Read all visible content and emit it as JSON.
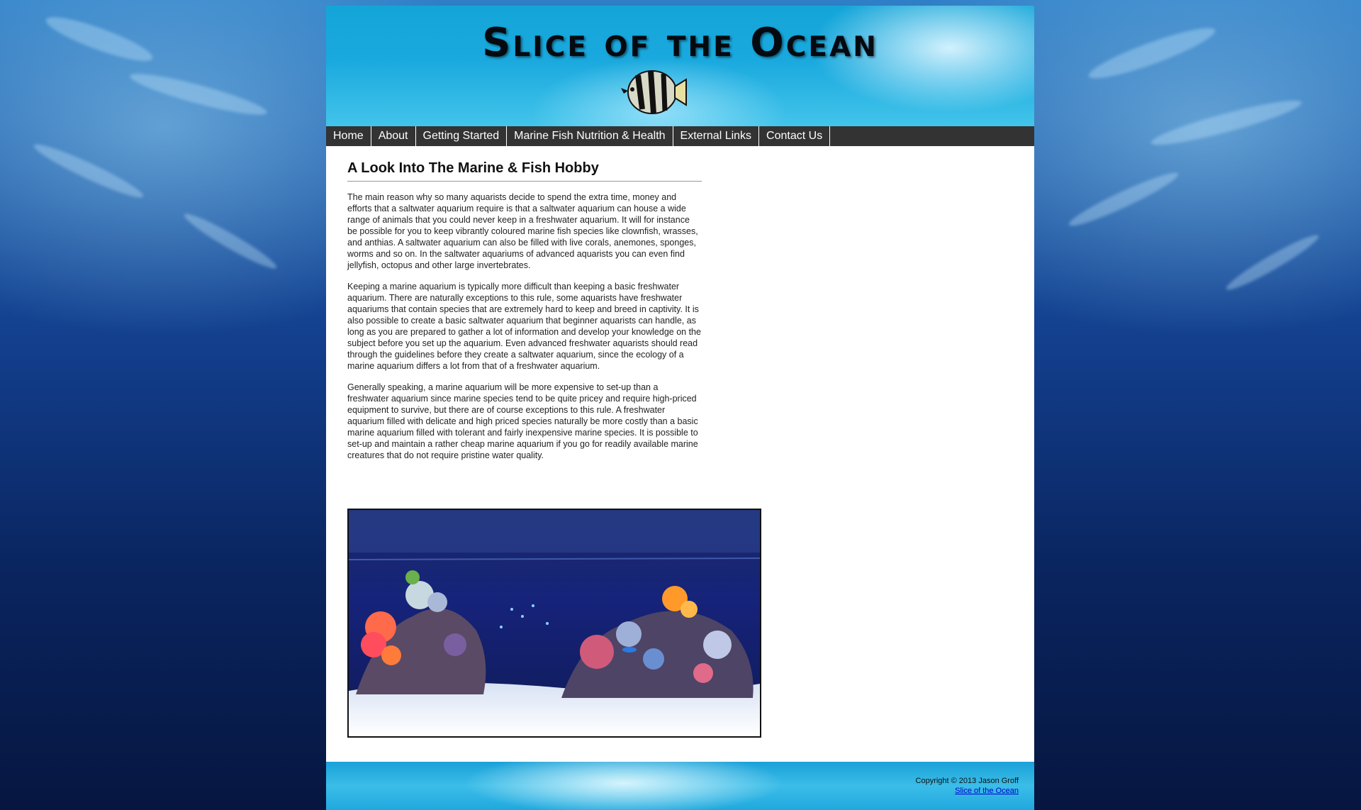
{
  "site": {
    "title": "Slice of the Ocean"
  },
  "nav": {
    "items": [
      {
        "label": "Home"
      },
      {
        "label": "About"
      },
      {
        "label": "Getting Started"
      },
      {
        "label": "Marine Fish Nutrition & Health"
      },
      {
        "label": "External Links"
      },
      {
        "label": "Contact Us"
      }
    ]
  },
  "main": {
    "heading": "A Look Into The Marine & Fish Hobby",
    "paragraphs": [
      "The main reason why so many aquarists decide to spend the extra time, money and efforts that a saltwater aquarium require is that a saltwater aquarium can house a wide range of animals that you could never keep in a freshwater aquarium. It will for instance be possible for you to keep vibrantly coloured marine fish species like clownfish, wrasses, and anthias. A saltwater aquarium can also be filled with live corals, anemones, sponges, worms and so on. In the saltwater aquariums of advanced aquarists you can even find jellyfish, octopus and other large invertebrates.",
      "Keeping a marine aquarium is typically more difficult than keeping a basic freshwater aquarium. There are naturally exceptions to this rule, some aquarists have freshwater aquariums that contain species that are extremely hard to keep and breed in captivity. It is also possible to create a basic saltwater aquarium that beginner aquarists can handle, as long as you are prepared to gather a lot of information and develop your knowledge on the subject before you set up the aquarium. Even advanced freshwater aquarists should read through the guidelines before they create a saltwater aquarium, since the ecology of a marine aquarium differs a lot from that of a freshwater aquarium.",
      "Generally speaking, a marine aquarium will be more expensive to set-up than a freshwater aquarium since marine species tend to be quite pricey and require high-priced equipment to survive, but there are of course exceptions to this rule. A freshwater aquarium filled with delicate and high priced species naturally be more costly than a basic marine aquarium filled with tolerant and fairly inexpensive marine species. It is possible to set-up and maintain a rather cheap marine aquarium if you go for readily available marine creatures that do not require pristine water quality."
    ]
  },
  "footer": {
    "copyright": "Copyright © 2013 Jason Groff",
    "link_text": "Slice of the Ocean"
  },
  "colors": {
    "nav_bg": "#333333",
    "link": "#0000cc",
    "header_blue": "#1aa9de"
  }
}
